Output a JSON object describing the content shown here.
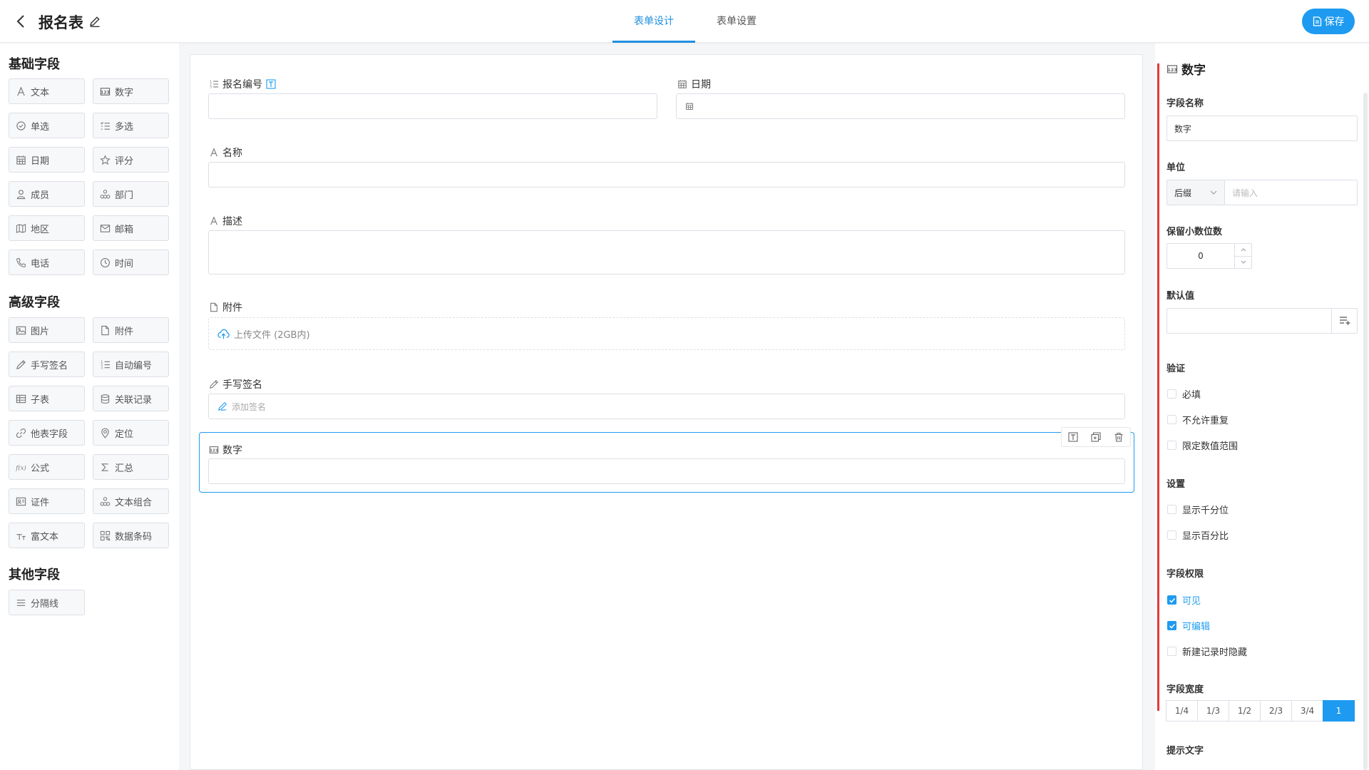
{
  "header": {
    "title": "报名表",
    "tabs": [
      {
        "label": "表单设计"
      },
      {
        "label": "表单设置"
      }
    ],
    "save_label": "保存"
  },
  "palette": {
    "basic_title": "基础字段",
    "basic": [
      {
        "label": "文本",
        "icon": "text-icon"
      },
      {
        "label": "数字",
        "icon": "number-icon"
      },
      {
        "label": "单选",
        "icon": "radio-icon"
      },
      {
        "label": "多选",
        "icon": "checklist-icon"
      },
      {
        "label": "日期",
        "icon": "calendar-icon"
      },
      {
        "label": "评分",
        "icon": "star-icon"
      },
      {
        "label": "成员",
        "icon": "user-icon"
      },
      {
        "label": "部门",
        "icon": "org-icon"
      },
      {
        "label": "地区",
        "icon": "map-icon"
      },
      {
        "label": "邮箱",
        "icon": "mail-icon"
      },
      {
        "label": "电话",
        "icon": "phone-icon"
      },
      {
        "label": "时间",
        "icon": "clock-icon"
      }
    ],
    "advanced_title": "高级字段",
    "advanced": [
      {
        "label": "图片",
        "icon": "image-icon"
      },
      {
        "label": "附件",
        "icon": "file-icon"
      },
      {
        "label": "手写签名",
        "icon": "pen-icon"
      },
      {
        "label": "自动编号",
        "icon": "numbered-list-icon"
      },
      {
        "label": "子表",
        "icon": "table-icon"
      },
      {
        "label": "关联记录",
        "icon": "database-icon"
      },
      {
        "label": "他表字段",
        "icon": "link-icon"
      },
      {
        "label": "定位",
        "icon": "location-icon"
      },
      {
        "label": "公式",
        "icon": "formula-icon"
      },
      {
        "label": "汇总",
        "icon": "sigma-icon"
      },
      {
        "label": "证件",
        "icon": "id-card-icon"
      },
      {
        "label": "文本组合",
        "icon": "org-icon"
      },
      {
        "label": "富文本",
        "icon": "rich-text-icon"
      },
      {
        "label": "数据条码",
        "icon": "qrcode-icon"
      }
    ],
    "other_title": "其他字段",
    "other": [
      {
        "label": "分隔线",
        "icon": "divider-icon"
      }
    ]
  },
  "form": {
    "reg_no_label": "报名编号",
    "date_label": "日期",
    "name_label": "名称",
    "desc_label": "描述",
    "attach_label": "附件",
    "upload_text": "上传文件 (2GB内)",
    "signature_label": "手写签名",
    "signature_placeholder": "添加签名",
    "number_label": "数字"
  },
  "props": {
    "title": "数字",
    "field_name_label": "字段名称",
    "field_name_value": "数字",
    "unit_label": "单位",
    "unit_select": "后缀",
    "unit_placeholder": "请输入",
    "decimals_label": "保留小数位数",
    "decimals_value": "0",
    "default_label": "默认值",
    "validate_label": "验证",
    "validate_opts": [
      {
        "label": "必填",
        "checked": false
      },
      {
        "label": "不允许重复",
        "checked": false
      },
      {
        "label": "限定数值范围",
        "checked": false
      }
    ],
    "settings_label": "设置",
    "settings_opts": [
      {
        "label": "显示千分位",
        "checked": false
      },
      {
        "label": "显示百分比",
        "checked": false
      }
    ],
    "perm_label": "字段权限",
    "perm_opts": [
      {
        "label": "可见",
        "checked": true
      },
      {
        "label": "可编辑",
        "checked": true
      },
      {
        "label": "新建记录时隐藏",
        "checked": false
      }
    ],
    "width_label": "字段宽度",
    "widths": [
      "1/4",
      "1/3",
      "1/2",
      "2/3",
      "3/4",
      "1"
    ],
    "width_selected": "1",
    "hint_label": "提示文字"
  },
  "colors": {
    "accent": "#1e9bf0",
    "marker": "#e5393a"
  }
}
